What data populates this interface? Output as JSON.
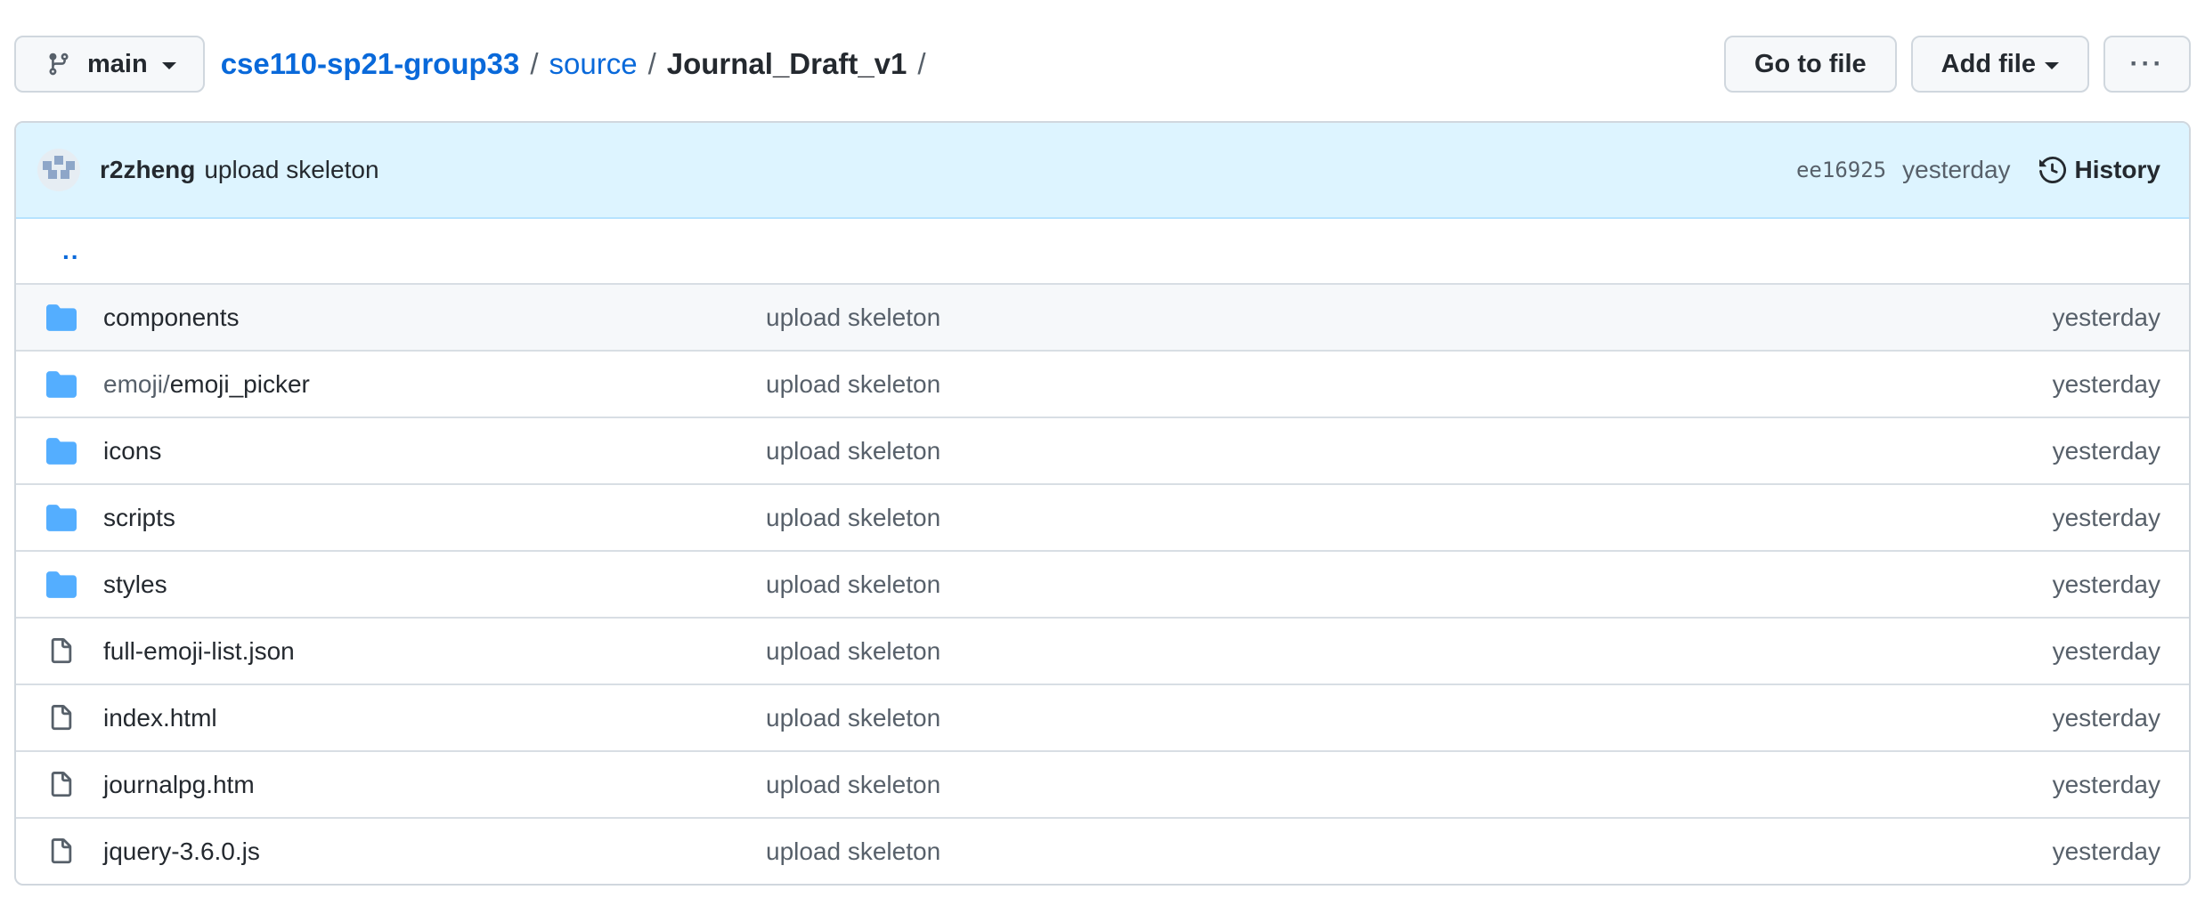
{
  "branch": {
    "label": "main",
    "icon": "git-branch-icon"
  },
  "breadcrumb": {
    "repo": "cse110-sp21-group33",
    "sep1": "/",
    "folder": "source",
    "sep2": "/",
    "current": "Journal_Draft_v1",
    "sep3": "/"
  },
  "actions": {
    "go_to_file": "Go to file",
    "add_file": "Add file",
    "more": "···"
  },
  "commit": {
    "author": "r2zheng",
    "message": "upload skeleton",
    "sha": "ee16925",
    "time": "yesterday",
    "history_label": "History"
  },
  "parent_link": "..",
  "files": [
    {
      "type": "folder",
      "prefix": "",
      "name": "components",
      "message": "upload skeleton",
      "age": "yesterday"
    },
    {
      "type": "folder",
      "prefix": "emoji/",
      "name": "emoji_picker",
      "message": "upload skeleton",
      "age": "yesterday"
    },
    {
      "type": "folder",
      "prefix": "",
      "name": "icons",
      "message": "upload skeleton",
      "age": "yesterday"
    },
    {
      "type": "folder",
      "prefix": "",
      "name": "scripts",
      "message": "upload skeleton",
      "age": "yesterday"
    },
    {
      "type": "folder",
      "prefix": "",
      "name": "styles",
      "message": "upload skeleton",
      "age": "yesterday"
    },
    {
      "type": "file",
      "prefix": "",
      "name": "full-emoji-list.json",
      "message": "upload skeleton",
      "age": "yesterday"
    },
    {
      "type": "file",
      "prefix": "",
      "name": "index.html",
      "message": "upload skeleton",
      "age": "yesterday"
    },
    {
      "type": "file",
      "prefix": "",
      "name": "journalpg.htm",
      "message": "upload skeleton",
      "age": "yesterday"
    },
    {
      "type": "file",
      "prefix": "",
      "name": "jquery-3.6.0.js",
      "message": "upload skeleton",
      "age": "yesterday"
    }
  ],
  "colors": {
    "link": "#0969da",
    "folder": "#54aeff",
    "file": "#57606a",
    "commit_bar": "#ddf4ff"
  }
}
